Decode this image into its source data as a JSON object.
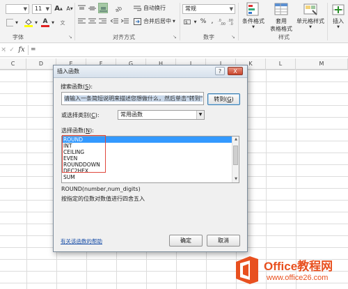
{
  "ribbon": {
    "font_size": "11",
    "font_grow": "A",
    "font_shrink": "A",
    "font_group_label": "字体",
    "wrap_text": "自动换行",
    "merge_center": "合并后居中",
    "alignment_group_label": "对齐方式",
    "number_format": "常规",
    "number_group_label": "数字",
    "conditional_format": "条件格式",
    "table_format_line1": "套用",
    "table_format_line2": "表格格式",
    "cell_style": "单元格样式",
    "styles_group_label": "样式",
    "insert": "插入",
    "percent": "%",
    "comma": ","
  },
  "formula_bar": {
    "fx": "fx",
    "equals": "="
  },
  "columns": [
    "C",
    "D",
    "E",
    "F",
    "G",
    "H",
    "I",
    "J",
    "K",
    "L",
    "M"
  ],
  "dialog": {
    "title": "插入函数",
    "help_btn": "?",
    "close_btn": "X",
    "search_label": "搜索函数(",
    "search_label_key": "S",
    "search_label_end": "):",
    "search_value": "请输入一条简短说明来描述您想做什么，然后单击\"转到\"",
    "goto_label": "转到(",
    "goto_key": "G",
    "goto_end": ")",
    "category_label": "或选择类别(",
    "category_key": "C",
    "category_end": "):",
    "category_value": "常用函数",
    "select_label": "选择函数(",
    "select_key": "N",
    "select_end": "):",
    "functions": [
      "ROUND",
      "INT",
      "CEILING",
      "EVEN",
      "ROUNDDOWN",
      "DEC2HEX",
      "SUM"
    ],
    "selected_index": 0,
    "signature": "ROUND(number,num_digits)",
    "description": "按指定的位数对数值进行四舍五入",
    "help_link": "有关该函数的帮助",
    "ok": "确定",
    "cancel": "取消"
  },
  "watermark": {
    "line1": "Office教程网",
    "line2": "www.office26.com",
    "accent": "#e8501f"
  }
}
